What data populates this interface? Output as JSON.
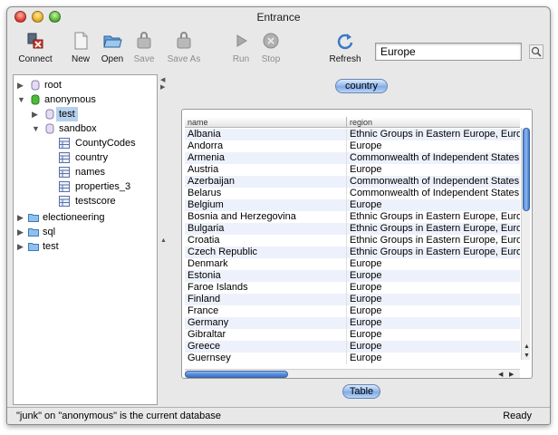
{
  "window": {
    "title": "Entrance"
  },
  "toolbar": {
    "buttons": [
      {
        "label": "Connect",
        "icon": "connect-icon",
        "enabled": true
      },
      {
        "label": "New",
        "icon": "new-document-icon",
        "enabled": true
      },
      {
        "label": "Open",
        "icon": "folder-open-icon",
        "enabled": true
      },
      {
        "label": "Save",
        "icon": "save-icon",
        "enabled": false
      },
      {
        "label": "Save As",
        "icon": "save-as-icon",
        "enabled": false
      },
      {
        "label": "Run",
        "icon": "play-icon",
        "enabled": false
      },
      {
        "label": "Stop",
        "icon": "stop-icon",
        "enabled": false
      },
      {
        "label": "Refresh",
        "icon": "refresh-icon",
        "enabled": true
      }
    ],
    "search_value": "Europe"
  },
  "tree": {
    "items": [
      {
        "label": "root",
        "icon": "database-icon",
        "state": "collapsed"
      },
      {
        "label": "anonymous",
        "icon": "database-active-icon",
        "state": "expanded"
      },
      {
        "label": "test",
        "icon": "database-icon",
        "state": "collapsed",
        "selected": true
      },
      {
        "label": "sandbox",
        "icon": "database-icon",
        "state": "expanded"
      },
      {
        "label": "CountyCodes",
        "icon": "table-icon"
      },
      {
        "label": "country",
        "icon": "table-icon"
      },
      {
        "label": "names",
        "icon": "table-icon"
      },
      {
        "label": "properties_3",
        "icon": "table-icon"
      },
      {
        "label": "testscore",
        "icon": "table-icon"
      },
      {
        "label": "electioneering",
        "icon": "folder-icon",
        "state": "collapsed"
      },
      {
        "label": "sql",
        "icon": "folder-icon",
        "state": "collapsed"
      },
      {
        "label": "test",
        "icon": "folder-icon",
        "state": "collapsed"
      }
    ]
  },
  "main": {
    "table_title": "country",
    "view_button": "Table",
    "columns": [
      "name",
      "region"
    ],
    "rows": [
      [
        "Albania",
        "Ethnic Groups in Eastern Europe,  Europe"
      ],
      [
        "Andorra",
        "Europe"
      ],
      [
        "Armenia",
        "Commonwealth of Independent States – Europe"
      ],
      [
        "Austria",
        "Europe"
      ],
      [
        "Azerbaijan",
        "Commonwealth of Independent States – Europe"
      ],
      [
        "Belarus",
        "Commonwealth of Independent States – Europe"
      ],
      [
        "Belgium",
        "Europe"
      ],
      [
        "Bosnia and Herzegovina",
        "Ethnic Groups in Eastern Europe,  Europe"
      ],
      [
        "Bulgaria",
        "Ethnic Groups in Eastern Europe,  Europe"
      ],
      [
        "Croatia",
        "Ethnic Groups in Eastern Europe,  Europe"
      ],
      [
        "Czech Republic",
        "Ethnic Groups in Eastern Europe,  Europe"
      ],
      [
        "Denmark",
        "Europe"
      ],
      [
        "Estonia",
        "Europe"
      ],
      [
        "Faroe Islands",
        "Europe"
      ],
      [
        "Finland",
        "Europe"
      ],
      [
        "France",
        "Europe"
      ],
      [
        "Germany",
        "Europe"
      ],
      [
        "Gibraltar",
        "Europe"
      ],
      [
        "Greece",
        "Europe"
      ],
      [
        "Guernsey",
        "Europe"
      ]
    ]
  },
  "status": {
    "message": "\"junk\" on \"anonymous\" is the current database",
    "state": "Ready"
  },
  "colors": {
    "row_alt": "#edf1fb",
    "selection": "#b6d0ef",
    "accent": "#4f86d6"
  }
}
